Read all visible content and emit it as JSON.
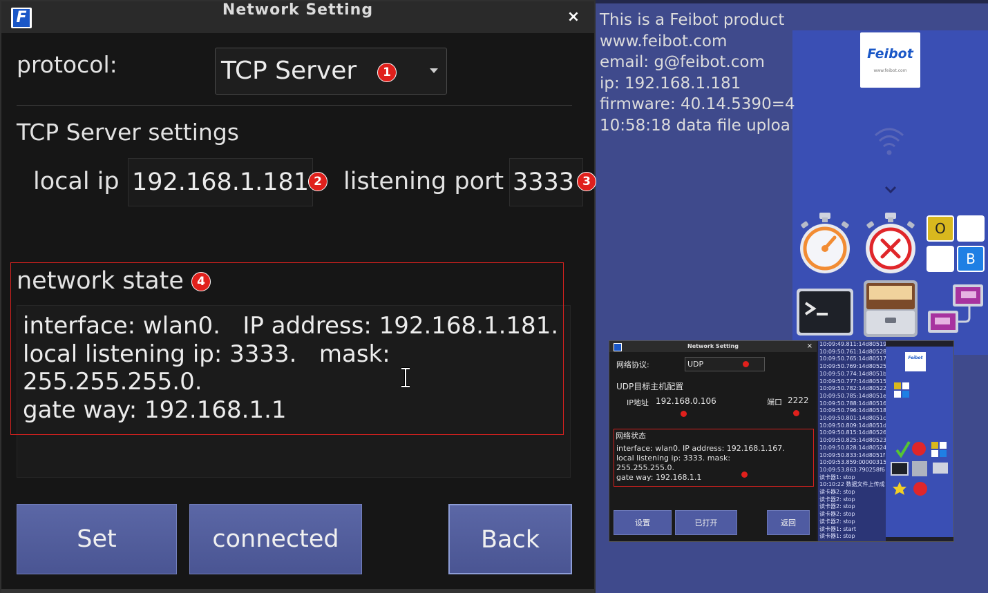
{
  "window": {
    "title": "Network Setting",
    "logo_letter": "F",
    "close_label": "×"
  },
  "protocol": {
    "label": "protocol:",
    "value": "TCP Server",
    "badge": "1"
  },
  "settings": {
    "title": "TCP Server settings",
    "local_ip_label": "local ip",
    "local_ip_value": "192.168.1.181",
    "local_ip_badge": "2",
    "port_label": "listening port",
    "port_value": "3333",
    "port_badge": "3"
  },
  "network_state": {
    "title": "network state",
    "badge": "4",
    "lines": [
      "interface: wlan0.   IP address: 192.168.1.181.",
      "local listening ip: 3333.   mask:",
      "255.255.255.0.",
      "gate way: 192.168.1.1"
    ]
  },
  "buttons": {
    "set": "Set",
    "connected": "connected",
    "back": "Back"
  },
  "info": {
    "lines": [
      "This is a Feibot product",
      "www.feibot.com",
      "email: g@feibot.com",
      "",
      "ip: 192.168.1.181",
      "firmware: 40.14.5390=4",
      "10:58:18 data file uploa"
    ]
  },
  "brand_logo": {
    "name": "Feibot",
    "sub": "www.feibot.com"
  },
  "desktop_icons": [
    "wifi-icon",
    "chevron-down-icon",
    "timer-icon",
    "cancel-timer-icon",
    "o-b-toggle-icon",
    "terminal-icon",
    "file-cabinet-icon",
    "remote-desktop-icon"
  ],
  "colors": {
    "accent_red": "#e0201c",
    "button_blue": "#4f5ba2",
    "desktop_blue": "#3f4a8c"
  },
  "mini": {
    "title": "Network Setting",
    "close_label": "×",
    "protocol_label": "网络协议:",
    "protocol_value": "UDP",
    "badge1": "1",
    "settings_title": "UDP目标主机配置",
    "ip_label": "IP地址",
    "ip_value": "192.168.0.106",
    "port_label": "端口",
    "port_value": "2222",
    "state_title": "网络状态",
    "state_lines": [
      "interface: wlan0.   IP address: 192.168.1.167.",
      "local listening ip: 3333.   mask:",
      "255.255.255.0.",
      "gate way: 192.168.1.1"
    ],
    "buttons": [
      "设置",
      "已打开",
      "返回"
    ],
    "log": [
      "10:09:49.811:14d80519",
      "10:09:50.761:14d80528",
      "10:09:50.765:14d80517",
      "10:09:50.769:14d80525",
      "10:09:50.774:14d8051b",
      "10:09:50.777:14d80515",
      "10:09:50.782:14d80522",
      "10:09:50.785:14d8051e",
      "10:09:50.788:14d80516",
      "10:09:50.796:14d80518",
      "10:09:50.801:14d8051c",
      "10:09:50.809:14d8051d",
      "10:09:50.815:14d80526",
      "10:09:50.825:14d80523",
      "10:09:50.828:14d80524",
      "10:09:50.833:14d8051f",
      "10:09:53.859:00000315",
      "10:09:53.863:790258f6",
      "读卡器1: stop",
      "10:10:22 数据文件上传成",
      "读卡器2: stop",
      "读卡器2: stop",
      "读卡器2: stop",
      "读卡器2: stop",
      "读卡器2: stop",
      "读卡器1: start",
      "读卡器1: stop"
    ]
  }
}
